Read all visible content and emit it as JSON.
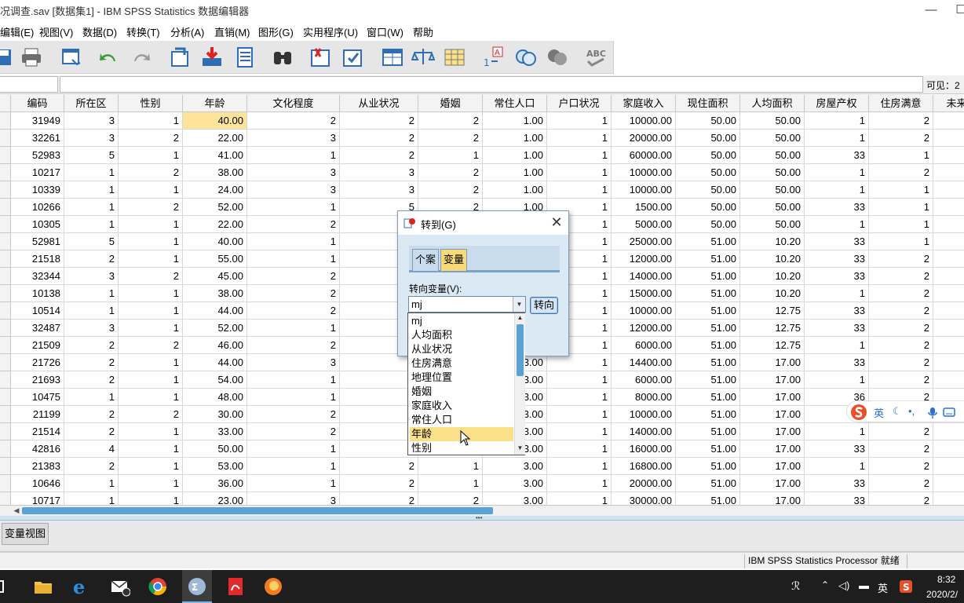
{
  "window": {
    "title": "况调查.sav [数据集1] - IBM SPSS Statistics 数据编辑器",
    "minimize_glyph": "—",
    "maximize_glyph": "☐"
  },
  "menu": [
    "编辑(E)",
    "视图(V)",
    "数据(D)",
    "转换(T)",
    "分析(A)",
    "直销(M)",
    "图形(G)",
    "实用程序(U)",
    "窗口(W)",
    "帮助"
  ],
  "cellbar": {
    "visible_label": "可见：2"
  },
  "grid": {
    "columns": [
      "编码",
      "所在区",
      "性别",
      "年龄",
      "文化程度",
      "从业状况",
      "婚姻",
      "常住人口",
      "户口状况",
      "家庭收入",
      "现住面积",
      "人均面积",
      "房屋产权",
      "住房满意",
      "未来"
    ],
    "selected_cell": {
      "row": 0,
      "col": 3
    },
    "rows": [
      [
        "31949",
        "3",
        "1",
        "40.00",
        "2",
        "2",
        "2",
        "1.00",
        "1",
        "10000.00",
        "50.00",
        "50.00",
        "1",
        "2",
        ""
      ],
      [
        "32261",
        "3",
        "2",
        "22.00",
        "3",
        "2",
        "2",
        "1.00",
        "1",
        "20000.00",
        "50.00",
        "50.00",
        "1",
        "2",
        ""
      ],
      [
        "52983",
        "5",
        "1",
        "41.00",
        "1",
        "2",
        "1",
        "1.00",
        "1",
        "60000.00",
        "50.00",
        "50.00",
        "33",
        "1",
        ""
      ],
      [
        "10217",
        "1",
        "2",
        "38.00",
        "3",
        "3",
        "2",
        "1.00",
        "1",
        "10000.00",
        "50.00",
        "50.00",
        "1",
        "2",
        ""
      ],
      [
        "10339",
        "1",
        "1",
        "24.00",
        "3",
        "3",
        "2",
        "1.00",
        "1",
        "10000.00",
        "50.00",
        "50.00",
        "1",
        "1",
        ""
      ],
      [
        "10266",
        "1",
        "2",
        "52.00",
        "1",
        "5",
        "2",
        "1.00",
        "1",
        "1500.00",
        "50.00",
        "50.00",
        "33",
        "1",
        ""
      ],
      [
        "10305",
        "1",
        "1",
        "22.00",
        "2",
        "",
        "",
        "",
        "1",
        "5000.00",
        "50.00",
        "50.00",
        "1",
        "1",
        ""
      ],
      [
        "52981",
        "5",
        "1",
        "40.00",
        "1",
        "",
        "",
        "",
        "1",
        "25000.00",
        "51.00",
        "10.20",
        "33",
        "1",
        ""
      ],
      [
        "21518",
        "2",
        "1",
        "55.00",
        "1",
        "",
        "",
        "",
        "1",
        "12000.00",
        "51.00",
        "10.20",
        "33",
        "2",
        ""
      ],
      [
        "32344",
        "3",
        "2",
        "45.00",
        "2",
        "",
        "",
        "",
        "1",
        "14000.00",
        "51.00",
        "10.20",
        "33",
        "2",
        ""
      ],
      [
        "10138",
        "1",
        "1",
        "38.00",
        "2",
        "",
        "",
        "",
        "1",
        "15000.00",
        "51.00",
        "10.20",
        "1",
        "2",
        ""
      ],
      [
        "10514",
        "1",
        "1",
        "44.00",
        "2",
        "",
        "",
        "",
        "1",
        "10000.00",
        "51.00",
        "12.75",
        "33",
        "2",
        ""
      ],
      [
        "32487",
        "3",
        "1",
        "52.00",
        "1",
        "",
        "",
        "",
        "1",
        "12000.00",
        "51.00",
        "12.75",
        "33",
        "2",
        ""
      ],
      [
        "21509",
        "2",
        "2",
        "46.00",
        "2",
        "",
        "",
        "",
        "1",
        "6000.00",
        "51.00",
        "12.75",
        "1",
        "2",
        ""
      ],
      [
        "21726",
        "2",
        "1",
        "44.00",
        "3",
        "",
        "",
        "3.00",
        "1",
        "14400.00",
        "51.00",
        "17.00",
        "33",
        "2",
        ""
      ],
      [
        "21693",
        "2",
        "1",
        "54.00",
        "1",
        "",
        "",
        "3.00",
        "1",
        "6000.00",
        "51.00",
        "17.00",
        "1",
        "2",
        ""
      ],
      [
        "10475",
        "1",
        "1",
        "48.00",
        "1",
        "",
        "",
        "3.00",
        "1",
        "8000.00",
        "51.00",
        "17.00",
        "36",
        "2",
        ""
      ],
      [
        "21199",
        "2",
        "2",
        "30.00",
        "2",
        "",
        "",
        "3.00",
        "1",
        "10000.00",
        "51.00",
        "17.00",
        "",
        "",
        ""
      ],
      [
        "21514",
        "2",
        "1",
        "33.00",
        "2",
        "",
        "",
        "3.00",
        "1",
        "14000.00",
        "51.00",
        "17.00",
        "1",
        "2",
        ""
      ],
      [
        "42816",
        "4",
        "1",
        "50.00",
        "1",
        "",
        "",
        "3.00",
        "1",
        "16000.00",
        "51.00",
        "17.00",
        "33",
        "2",
        ""
      ],
      [
        "21383",
        "2",
        "1",
        "53.00",
        "1",
        "2",
        "1",
        "3.00",
        "1",
        "16800.00",
        "51.00",
        "17.00",
        "1",
        "2",
        ""
      ],
      [
        "10646",
        "1",
        "1",
        "36.00",
        "1",
        "2",
        "1",
        "3.00",
        "1",
        "20000.00",
        "51.00",
        "17.00",
        "33",
        "2",
        ""
      ],
      [
        "10717",
        "1",
        "1",
        "23.00",
        "3",
        "2",
        "2",
        "3.00",
        "1",
        "30000.00",
        "51.00",
        "17.00",
        "33",
        "2",
        ""
      ]
    ]
  },
  "view_tab": "变量视图",
  "status": {
    "processor": "IBM SPSS Statistics Processor 就绪"
  },
  "dialog": {
    "title": "转到(G)",
    "close_glyph": "✕",
    "tabs": [
      "个案",
      "变量"
    ],
    "active_tab": 1,
    "field_label": "转向变量(V):",
    "field_value": "mj",
    "go_button": "转向",
    "options": [
      "mj",
      "人均面积",
      "从业状况",
      "住房满意",
      "地理位置",
      "婚姻",
      "家庭收入",
      "常住人口",
      "年龄",
      "性别"
    ],
    "highlighted_option": 8
  },
  "ime": {
    "lang": "英"
  },
  "taskbar": {
    "time": "8:32",
    "date": "2020/2/",
    "lang": "英"
  },
  "colors": {
    "accent": "#5aa2d6",
    "selected_cell": "#fde49a",
    "dialog_bg": "#dbe9f5",
    "active_tab": "#f7d978"
  }
}
